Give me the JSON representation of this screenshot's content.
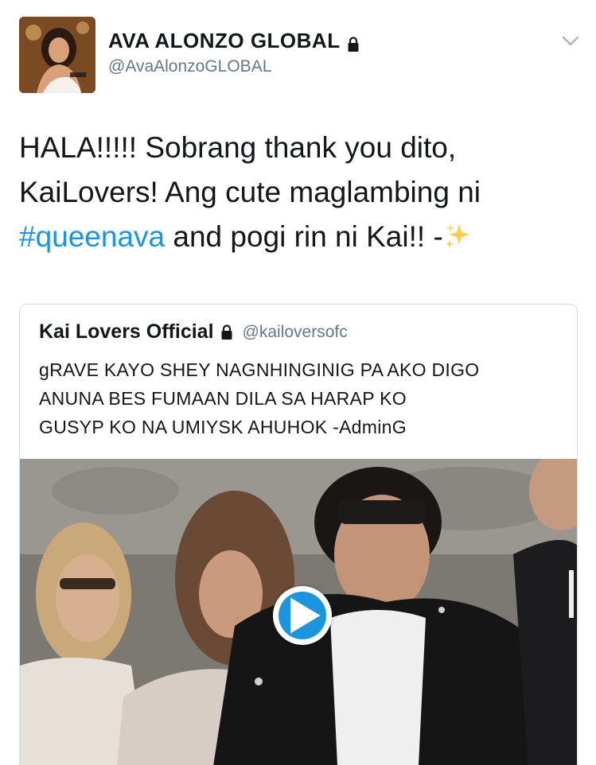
{
  "tweet": {
    "author_name": "AVA ALONZO GLOBAL",
    "author_handle": "@AvaAlonzoGLOBAL",
    "text_line1": "HALA!!!!! Sobrang thank you dito,",
    "text_line2": "KaiLovers! Ang cute maglambing ni",
    "hashtag": "#queenava",
    "text_line3_rest": " and pogi rin ni Kai!! -",
    "emoji_icon": "sparkles-icon"
  },
  "quote": {
    "author_name": "Kai Lovers Official",
    "author_handle": "@kailoversofc",
    "text_line1": "gRAVE KAYO SHEY NAGNHINGINIG PA AKO DIGO",
    "text_line2": "ANUNA BES FUMAAN DILA SA HARAP KO",
    "text_line3": "GUSYP KO NA UMIYSK AHUHOK -AdminG"
  },
  "colors": {
    "link": "#1b95e0",
    "secondary_text": "#657786",
    "border": "#d3dbe2"
  }
}
